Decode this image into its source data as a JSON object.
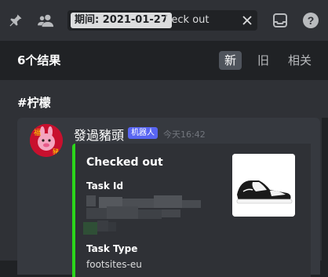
{
  "search": {
    "filter_tag": "期间: 2021-01-27",
    "query": "check out"
  },
  "results": {
    "count_label": "6个结果",
    "sort_tabs": [
      {
        "label": "新",
        "active": true
      },
      {
        "label": "旧",
        "active": false
      },
      {
        "label": "相关",
        "active": false
      }
    ]
  },
  "channel": {
    "name": "#柠檬"
  },
  "message": {
    "author": "發過豬頭",
    "bot_tag": "机器人",
    "timestamp": "今天16:42",
    "embed": {
      "accent_color": "#2bd61b",
      "title": "Checked out",
      "fields": [
        {
          "name": "Task Id",
          "value": ""
        },
        {
          "name": "Task Type",
          "value": "footsites-eu"
        }
      ]
    }
  },
  "colors": {
    "topbar": "#2f3136",
    "results_header": "#202225",
    "message_bg": "#36393f",
    "bot_tag": "#5865f2"
  },
  "icons": [
    "pin-icon",
    "members-icon",
    "close-icon",
    "inbox-icon",
    "help-icon"
  ]
}
